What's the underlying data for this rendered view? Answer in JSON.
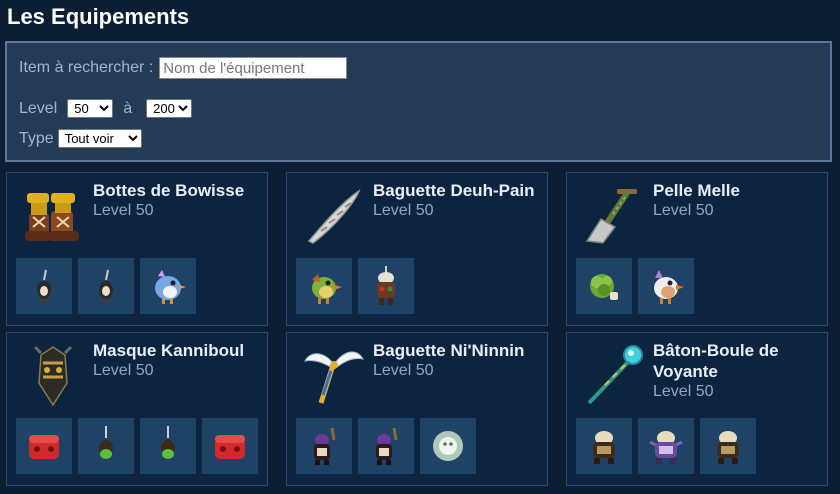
{
  "page": {
    "title": "Les Equipements"
  },
  "filters": {
    "search_label": "Item à rechercher :",
    "search_placeholder": "Nom de l'équipement",
    "level_label": "Level",
    "level_min": "50",
    "level_sep": "à",
    "level_max": "200",
    "type_label": "Type",
    "type_value": "Tout voir"
  },
  "items": [
    {
      "name": "Bottes de Bowisse",
      "level": "Level 50",
      "icon": "boots-icon",
      "drops": [
        "bird-idol-icon",
        "bird-idol-icon",
        "blue-bird-icon"
      ]
    },
    {
      "name": "Baguette Deuh-Pain",
      "level": "Level 50",
      "icon": "bread-wand-icon",
      "drops": [
        "green-bird-icon",
        "totem-creature-icon"
      ]
    },
    {
      "name": "Pelle Melle",
      "level": "Level 50",
      "icon": "shovel-icon",
      "drops": [
        "green-cabbage-icon",
        "white-bird-icon"
      ]
    },
    {
      "name": "Masque Kanniboul",
      "level": "Level 50",
      "icon": "mask-icon",
      "drops": [
        "red-chest-icon",
        "green-idol-icon",
        "green-idol-icon",
        "red-chest-icon"
      ]
    },
    {
      "name": "Baguette Ni'Ninnin",
      "level": "Level 50",
      "icon": "winged-wand-icon",
      "drops": [
        "dark-creature-icon",
        "dark-creature-icon",
        "ghost-icon"
      ]
    },
    {
      "name": "Bâton-Boule de Voyante",
      "level": "Level 50",
      "icon": "orb-staff-icon",
      "drops": [
        "armored-creature-icon",
        "purple-creature-icon",
        "armored-creature-icon"
      ]
    }
  ],
  "colors": {
    "background": "#0b1e33",
    "panel": "#243b56",
    "card": "#0d2440",
    "drop_tile": "#1f4366"
  }
}
